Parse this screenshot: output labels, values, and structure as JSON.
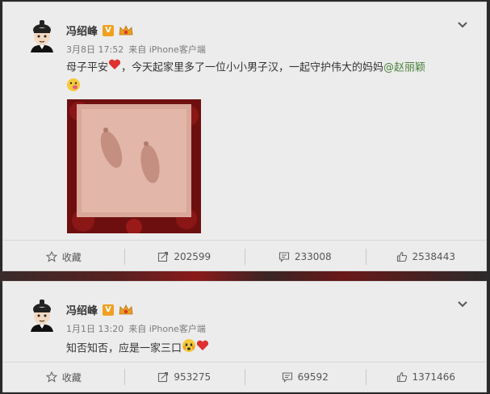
{
  "posts": [
    {
      "username": "冯绍峰",
      "verified_badge": "V",
      "time": "3月8日 17:52",
      "source": "来自 iPhone客户端",
      "text_before": "母子平安",
      "text_middle": "，今天起家里多了一位小小男子汉，一起守护伟大的妈妈",
      "mention": "@赵丽颖",
      "actions": {
        "favorite_label": "收藏",
        "repost_count": "202599",
        "comment_count": "233008",
        "like_count": "2538443"
      }
    },
    {
      "username": "冯绍峰",
      "verified_badge": "V",
      "time": "1月1日 13:20",
      "source": "来自 iPhone客户端",
      "text_before": "知否知否，应是一家三口",
      "actions": {
        "favorite_label": "收藏",
        "repost_count": "953275",
        "comment_count": "69592",
        "like_count": "1371466"
      }
    }
  ],
  "colors": {
    "card_bg": "#ececec",
    "mention": "#4a7f3a",
    "badge": "#f0a020",
    "heart": "#e03030"
  },
  "icons": [
    "avatar",
    "verified-icon",
    "crown-icon",
    "chevron-down-icon",
    "heart-icon",
    "emoji-icon",
    "star-icon",
    "repost-icon",
    "comment-icon",
    "thumbs-up-icon"
  ]
}
